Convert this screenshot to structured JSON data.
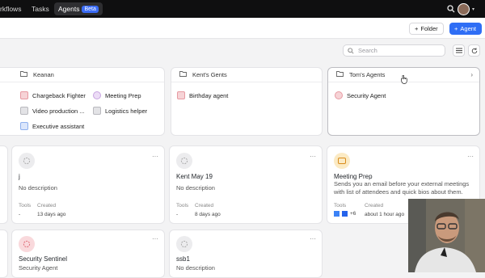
{
  "nav": {
    "workflows": "rkflows",
    "tasks": "Tasks",
    "agents": "Agents",
    "beta": "Beta"
  },
  "toolbar": {
    "folder_label": "Folder",
    "agent_label": "Agent",
    "search_placeholder": "Search"
  },
  "folders": [
    {
      "name": "Keanan",
      "items": [
        "Chargeback Fighter",
        "Meeting Prep",
        "Video production ...",
        "Logistics helper",
        "Executive assistant"
      ]
    },
    {
      "name": "Kent's Gents",
      "items": [
        "Birthday agent"
      ]
    },
    {
      "name": "Tom's Agents",
      "items": [
        "Security Agent"
      ]
    }
  ],
  "agents": [
    {
      "name": "j",
      "description": "No description",
      "tools_label": "Tools",
      "created_label": "Created",
      "tools": "-",
      "created": "13 days ago"
    },
    {
      "name": "Kent May 19",
      "description": "No description",
      "tools_label": "Tools",
      "created_label": "Created",
      "tools": "-",
      "created": "8 days ago"
    },
    {
      "name": "Meeting Prep",
      "description": "Sends you an email before your external meetings with list of attendees and quick bios about them.",
      "tools_label": "Tools",
      "created_label": "Created",
      "tools_more": "+6",
      "created": "about 1 hour ago"
    },
    {
      "name": "Security Sentinel",
      "description": "Security Agent"
    },
    {
      "name": "ssb1",
      "description": "No description"
    }
  ],
  "colors": {
    "accent": "#2f6ef5",
    "topbar": "#0f0f10",
    "page_bg": "#f3f3f4"
  }
}
